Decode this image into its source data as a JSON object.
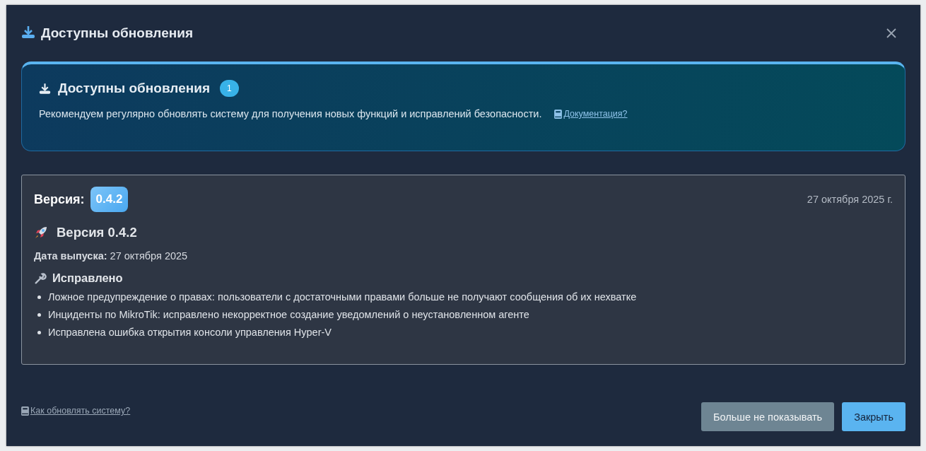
{
  "dialog": {
    "title": "Доступны обновления"
  },
  "banner": {
    "title": "Доступны обновления",
    "count": "1",
    "text": "Рекомендуем регулярно обновлять систему для получения новых функций и исправлений безопасности.",
    "link": "Документация?"
  },
  "release": {
    "label": "Версия:",
    "version": "0.4.2",
    "date": "27 октября 2025 г.",
    "heading": "Версия 0.4.2",
    "release_date_label": "Дата выпуска:",
    "release_date": "27 октября 2025",
    "section": "Исправлено",
    "items": [
      "Ложное предупреждение о правах: пользователи с достаточными правами больше не получают сообщения об их нехватке",
      "Инциденты по MikroTik: исправлено некорректное создание уведомлений о неустановленном агенте",
      "Исправлена ошибка открытия консоли управления Hyper-V"
    ]
  },
  "footer": {
    "link": "Как обновлять систему?",
    "buttons": [
      {
        "label": "Больше не показывать",
        "kind": "secondary"
      },
      {
        "label": "Закрыть",
        "kind": "primary"
      }
    ]
  }
}
